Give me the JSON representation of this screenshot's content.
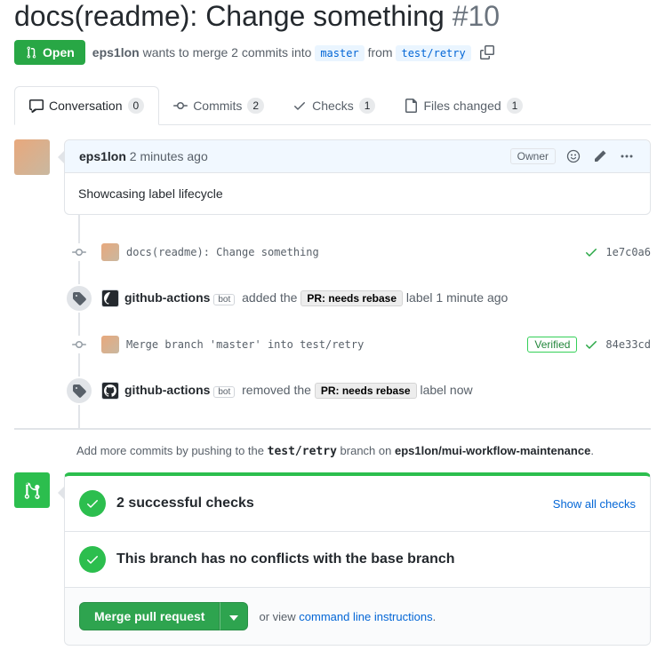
{
  "pr": {
    "title": "docs(readme): Change something",
    "number": "#10"
  },
  "state": {
    "badge": "Open",
    "author": "eps1lon",
    "wants_text": "wants to merge 2 commits into",
    "base_branch": "master",
    "from_text": "from",
    "head_branch": "test/retry"
  },
  "tabs": {
    "conversation": {
      "label": "Conversation",
      "count": "0"
    },
    "commits": {
      "label": "Commits",
      "count": "2"
    },
    "checks": {
      "label": "Checks",
      "count": "1"
    },
    "files": {
      "label": "Files changed",
      "count": "1"
    }
  },
  "comment": {
    "author": "eps1lon",
    "time": "2 minutes ago",
    "owner_badge": "Owner",
    "body": "Showcasing label lifecycle"
  },
  "commit1": {
    "msg": "docs(readme): Change something",
    "sha": "1e7c0a6"
  },
  "label_add": {
    "actor": "github-actions",
    "bot": "bot",
    "verb": "added the",
    "label": "PR: needs rebase",
    "suffix": "label 1 minute ago"
  },
  "commit2": {
    "msg": "Merge branch 'master' into test/retry",
    "sha": "84e33cd",
    "verified": "Verified"
  },
  "label_rem": {
    "actor": "github-actions",
    "bot": "bot",
    "verb": "removed the",
    "label": "PR: needs rebase",
    "suffix": "label now"
  },
  "push_hint": {
    "prefix": "Add more commits by pushing to the",
    "branch": "test/retry",
    "mid": "branch on",
    "repo": "eps1lon/mui-workflow-maintenance"
  },
  "merge": {
    "checks_title": "2 successful checks",
    "show_all": "Show all checks",
    "no_conflicts": "This branch has no conflicts with the base branch",
    "button": "Merge pull request",
    "cli_prefix": "or view",
    "cli_link": "command line instructions"
  }
}
